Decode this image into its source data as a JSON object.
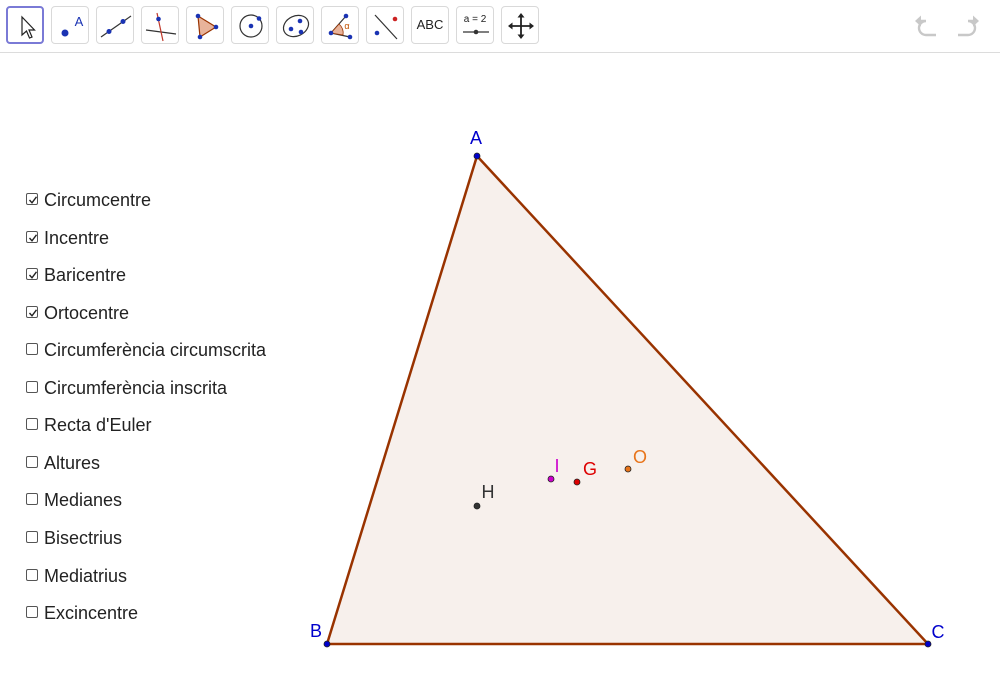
{
  "toolbar": {
    "tools": [
      {
        "name": "move"
      },
      {
        "name": "point",
        "label": "A"
      },
      {
        "name": "line"
      },
      {
        "name": "perpendicular-line"
      },
      {
        "name": "polygon"
      },
      {
        "name": "circle-center-point"
      },
      {
        "name": "ellipse"
      },
      {
        "name": "angle",
        "label": "α"
      },
      {
        "name": "reflect"
      },
      {
        "name": "text",
        "label": "ABC"
      },
      {
        "name": "slider",
        "label": "a = 2"
      },
      {
        "name": "move-graphics-view"
      }
    ],
    "selected": "move"
  },
  "checkboxes": [
    {
      "label": "Circumcentre",
      "checked": true
    },
    {
      "label": "Incentre",
      "checked": true
    },
    {
      "label": "Baricentre",
      "checked": true
    },
    {
      "label": "Ortocentre",
      "checked": true
    },
    {
      "label": "Circumferència circumscrita",
      "checked": false
    },
    {
      "label": "Circumferència inscrita",
      "checked": false
    },
    {
      "label": "Recta d'Euler",
      "checked": false
    },
    {
      "label": "Altures",
      "checked": false
    },
    {
      "label": "Medianes",
      "checked": false
    },
    {
      "label": "Bisectrius",
      "checked": false
    },
    {
      "label": "Mediatrius",
      "checked": false
    },
    {
      "label": "Excincentre",
      "checked": false
    }
  ],
  "figure": {
    "vertices": [
      {
        "label": "A"
      },
      {
        "label": "B"
      },
      {
        "label": "C"
      }
    ],
    "centers": [
      {
        "label": "I",
        "color": "#cc00cc"
      },
      {
        "label": "G",
        "color": "#dd0000"
      },
      {
        "label": "O",
        "color": "#e8741a"
      },
      {
        "label": "H",
        "color": "#333333"
      }
    ],
    "colors": {
      "triangle_stroke": "#993300",
      "triangle_fill": "#f7f0ec",
      "vertex": "#0000cc"
    }
  }
}
